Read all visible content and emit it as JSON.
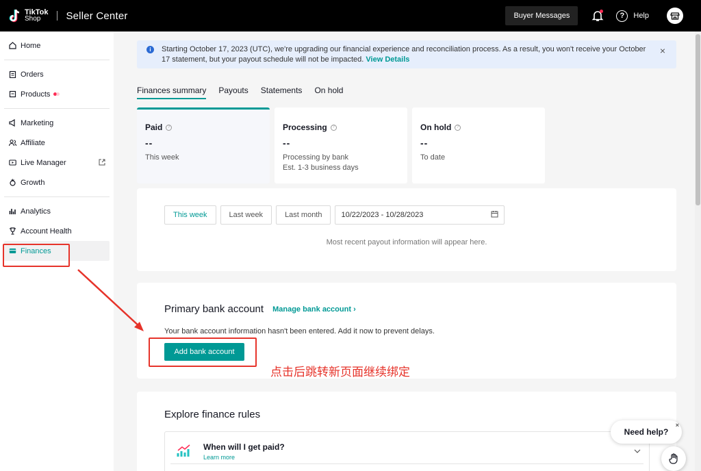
{
  "topbar": {
    "logo_line1": "TikTok",
    "logo_line2": "Shop",
    "title": "Seller Center",
    "buyer_messages": "Buyer Messages",
    "help": "Help"
  },
  "sidebar": {
    "home": "Home",
    "orders": "Orders",
    "products": "Products",
    "marketing": "Marketing",
    "affiliate": "Affiliate",
    "live_manager": "Live Manager",
    "growth": "Growth",
    "analytics": "Analytics",
    "account_health": "Account Health",
    "finances": "Finances"
  },
  "banner": {
    "text": "Starting October 17, 2023 (UTC), we're upgrading our financial experience and reconciliation process. As a result, you won't receive your October 17 statement, but your payout schedule will not be impacted.",
    "link": "View Details"
  },
  "tabs": [
    "Finances summary",
    "Payouts",
    "Statements",
    "On hold"
  ],
  "cards": [
    {
      "title": "Paid",
      "value": "--",
      "sub1": "This week",
      "sub2": ""
    },
    {
      "title": "Processing",
      "value": "--",
      "sub1": "Processing by bank",
      "sub2": "Est. 1-3 business days"
    },
    {
      "title": "On hold",
      "value": "--",
      "sub1": "To date",
      "sub2": ""
    }
  ],
  "filters": {
    "this_week": "This week",
    "last_week": "Last week",
    "last_month": "Last month",
    "date_range": "10/22/2023 - 10/28/2023",
    "empty_text": "Most recent payout information will appear here."
  },
  "bank": {
    "title": "Primary bank account",
    "manage": "Manage bank account",
    "desc": "Your bank account information hasn't been entered. Add it now to prevent delays.",
    "add_button": "Add bank account"
  },
  "rules": {
    "title": "Explore finance rules",
    "question": "When will I get paid?",
    "learn_more": "Learn more"
  },
  "annotation": {
    "text": "点击后跳转新页面继续绑定",
    "color": "#e6332a"
  },
  "widget": {
    "need_help": "Need help?"
  },
  "colors": {
    "accent": "#009995",
    "topbar": "#000000"
  }
}
